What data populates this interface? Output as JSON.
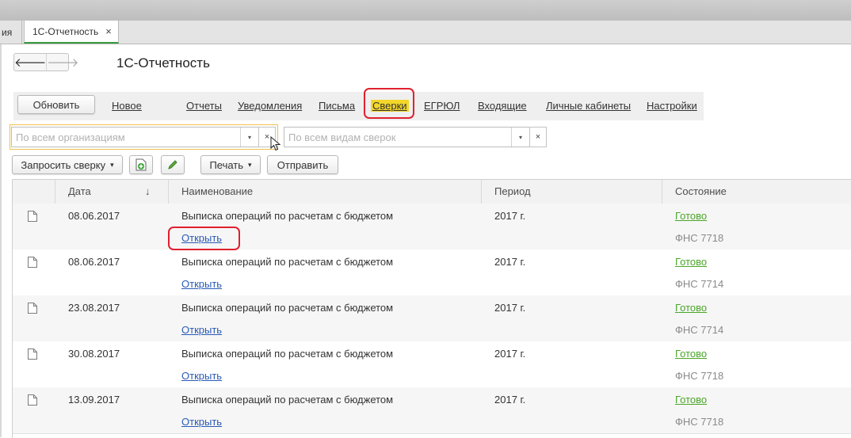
{
  "tabs": {
    "prev_label": "ия",
    "active_label": "1С-Отчетность",
    "close_glyph": "×"
  },
  "nav": {
    "back_glyph": "🡐",
    "forward_glyph": "🡒"
  },
  "page_title": "1С-Отчетность",
  "menu": {
    "refresh_label": "Обновить",
    "new_label": "Новое",
    "links": [
      "Отчеты",
      "Уведомления",
      "Письма",
      "Сверки",
      "ЕГРЮЛ",
      "Входящие",
      "Личные кабинеты",
      "Настройки"
    ],
    "active_link": "Сверки"
  },
  "filters": {
    "org_placeholder": "По всем организациям",
    "type_placeholder": "По всем видам сверок",
    "dropdown_glyph": "▾",
    "clear_glyph": "×"
  },
  "toolbar": {
    "request_label": "Запросить сверку",
    "print_label": "Печать",
    "send_label": "Отправить",
    "dropdown_glyph": "▾"
  },
  "table": {
    "columns": {
      "date": "Дата",
      "name": "Наименование",
      "period": "Период",
      "status": "Состояние"
    },
    "sort_glyph": "↓",
    "rows": [
      {
        "date": "08.06.2017",
        "name": "Выписка операций по расчетам с бюджетом",
        "link": "Открыть",
        "period": "2017 г.",
        "status": "Готово",
        "authority": "ФНС 7718"
      },
      {
        "date": "08.06.2017",
        "name": "Выписка операций по расчетам с бюджетом",
        "link": "Открыть",
        "period": "2017 г.",
        "status": "Готово",
        "authority": "ФНС 7714"
      },
      {
        "date": "23.08.2017",
        "name": "Выписка операций по расчетам с бюджетом",
        "link": "Открыть",
        "period": "2017 г.",
        "status": "Готово",
        "authority": "ФНС 7714"
      },
      {
        "date": "30.08.2017",
        "name": "Выписка операций по расчетам с бюджетом",
        "link": "Открыть",
        "period": "2017 г.",
        "status": "Готово",
        "authority": "ФНС 7718"
      },
      {
        "date": "13.09.2017",
        "name": "Выписка операций по расчетам с бюджетом",
        "link": "Открыть",
        "period": "2017 г.",
        "status": "Готово",
        "authority": "ФНС 7718"
      }
    ]
  },
  "colors": {
    "highlight": "#f3d62a",
    "annotation_red": "#e0202e",
    "link_blue": "#2a5ab5",
    "status_green": "#4aa629",
    "focus_orange": "#f0c250"
  }
}
